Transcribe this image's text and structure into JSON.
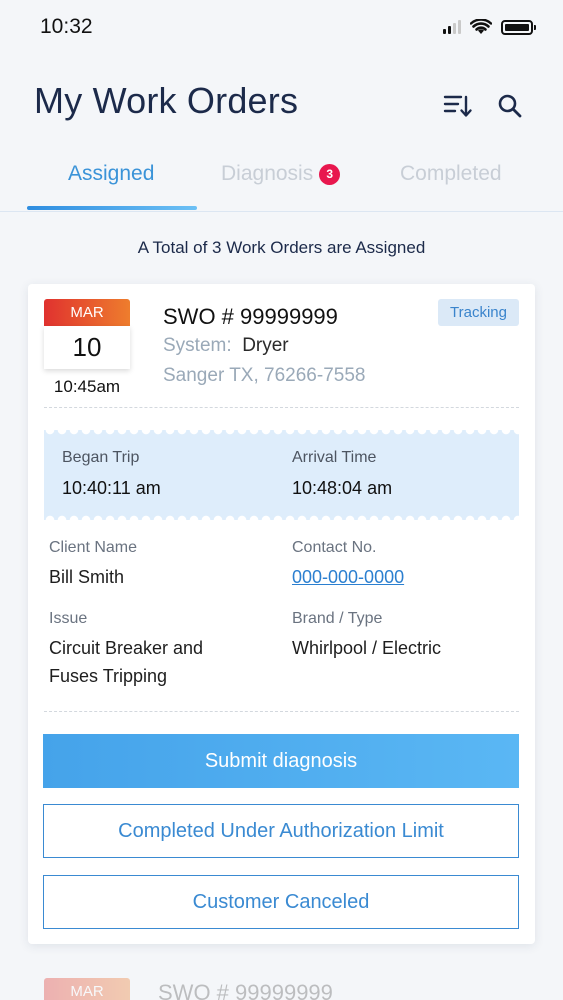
{
  "status_bar": {
    "time": "10:32"
  },
  "header": {
    "title": "My Work Orders"
  },
  "tabs": [
    {
      "label": "Assigned",
      "active": true
    },
    {
      "label": "Diagnosis",
      "badge": "3",
      "active": false
    },
    {
      "label": "Completed",
      "active": false
    }
  ],
  "summary": "A Total of 3 Work Orders are Assigned",
  "work_order": {
    "month": "MAR",
    "day": "10",
    "time": "10:45am",
    "swo": "SWO # 99999999",
    "system_label": "System:",
    "system_value": "Dryer",
    "address": "Sanger TX, 76266-7558",
    "status": "Tracking",
    "began_trip_label": "Began Trip",
    "began_trip_value": "10:40:11 am",
    "arrival_label": "Arrival Time",
    "arrival_value": "10:48:04 am",
    "client_label": "Client Name",
    "client_value": "Bill Smith",
    "contact_label": "Contact No.",
    "contact_value": "000-000-0000",
    "issue_label": "Issue",
    "issue_value_line1": "Circuit Breaker and",
    "issue_value_line2": "Fuses Tripping",
    "brand_label": "Brand / Type",
    "brand_value": "Whirlpool / Electric",
    "actions": {
      "submit": "Submit diagnosis",
      "completed_under_limit": "Completed Under Authorization Limit",
      "customer_canceled": "Customer Canceled"
    }
  },
  "next_work_order": {
    "month": "MAR",
    "swo": "SWO # 99999999"
  },
  "colors": {
    "accent": "#3a93d8",
    "badge": "#e8174e",
    "title": "#1c2a4a"
  }
}
